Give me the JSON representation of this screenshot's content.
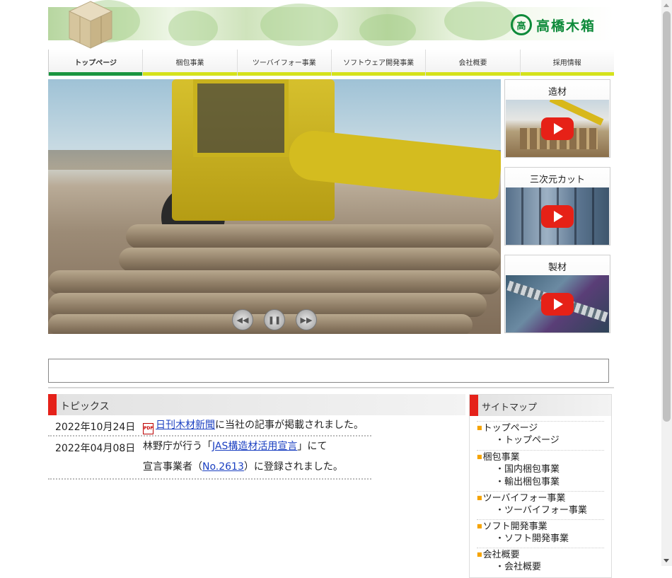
{
  "header": {
    "company_name": "高橋木箱",
    "emblem": "高",
    "brand_color": "#0e8a3a"
  },
  "nav": {
    "tabs": [
      {
        "label": "トップページ",
        "active": true
      },
      {
        "label": "梱包事業"
      },
      {
        "label": "ツーバイフォー事業"
      },
      {
        "label": "ソフトウェア開発事業"
      },
      {
        "label": "会社概要"
      },
      {
        "label": "採用情報"
      }
    ]
  },
  "slideshow": {
    "controls": {
      "prev": "prev-icon",
      "pause": "pause-icon",
      "next": "next-icon"
    }
  },
  "videos": [
    {
      "title": "造材"
    },
    {
      "title": "三次元カット"
    },
    {
      "title": "製材"
    }
  ],
  "topics": {
    "heading": "トピックス",
    "items": [
      {
        "date": "2022年10月24日",
        "link": "日刊木材新聞",
        "text": "に当社の記事が掲載されました。"
      },
      {
        "date": "2022年04月08日",
        "text_a": "林野庁が行う「",
        "link_a": "JAS構造材活用宣言",
        "text_b": "」にて",
        "text_c": "宣言事業者（",
        "link_b": "No.2613",
        "text_d": "）に登録されました。"
      }
    ]
  },
  "sitemap": {
    "heading": "サイトマップ",
    "sections": [
      {
        "category": "トップページ",
        "items": [
          "・トップページ"
        ]
      },
      {
        "category": "梱包事業",
        "items": [
          "・国内梱包事業",
          "・輸出梱包事業"
        ]
      },
      {
        "category": "ツーバイフォー事業",
        "items": [
          "・ツーバイフォー事業"
        ]
      },
      {
        "category": "ソフト開発事業",
        "items": [
          "・ソフト開発事業"
        ]
      },
      {
        "category": "会社概要",
        "items": [
          "・会社概要"
        ]
      }
    ]
  },
  "colors": {
    "accent_red": "#e5221a",
    "nav_active": "#1a9540",
    "nav_underline": "#d5e21c",
    "link": "#1a3fc1"
  }
}
